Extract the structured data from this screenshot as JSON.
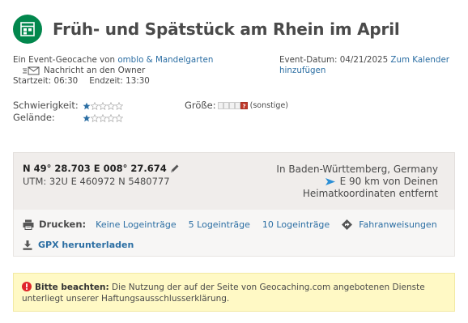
{
  "header": {
    "title": "Früh- und Spätstück am Rhein im April",
    "icon": "event-cache-icon"
  },
  "owner": {
    "prefix": "Ein Event-Geocache von",
    "owner_name": "omblo & Mandelgarten",
    "message_label": "Nachricht an den Owner",
    "start_time": "Startzeit: 06:30",
    "end_time": "Endzeit: 13:30"
  },
  "event": {
    "date_label": "Event-Datum: 04/21/2025",
    "calendar_link": "Zum Kalender hinzufügen"
  },
  "ratings": {
    "difficulty_label": "Schwierigkeit:",
    "difficulty_value": 1,
    "terrain_label": "Gelände:",
    "terrain_value": 1,
    "max_stars": 5,
    "size_label": "Größe:",
    "size_value": "(sonstige)"
  },
  "coordinates": {
    "latlon": "N 49° 28.703 E 008° 27.674",
    "utm": "UTM: 32U E 460972 N 5480777",
    "region": "In Baden-Württemberg, Germany",
    "distance": "E 90 km von Deinen",
    "distance_suffix": "Heimatkoordinaten entfernt"
  },
  "print": {
    "label": "Drucken:",
    "options": [
      "Keine Logeinträge",
      "5 Logeinträge",
      "10 Logeinträge"
    ],
    "directions": "Fahranweisungen",
    "gpx": "GPX herunterladen"
  },
  "notice": {
    "heading": "Bitte beachten:",
    "text": "Die Nutzung der auf der Seite von Geocaching.com angebotenen Dienste unterliegt unserer Haftungsausschlusserklärung."
  },
  "colors": {
    "brand_green": "#02874d",
    "link_blue": "#2b6ea3",
    "star_blue": "#2b6ea3",
    "notice_bg": "#fff9c5",
    "warn_red": "#e0262b"
  }
}
